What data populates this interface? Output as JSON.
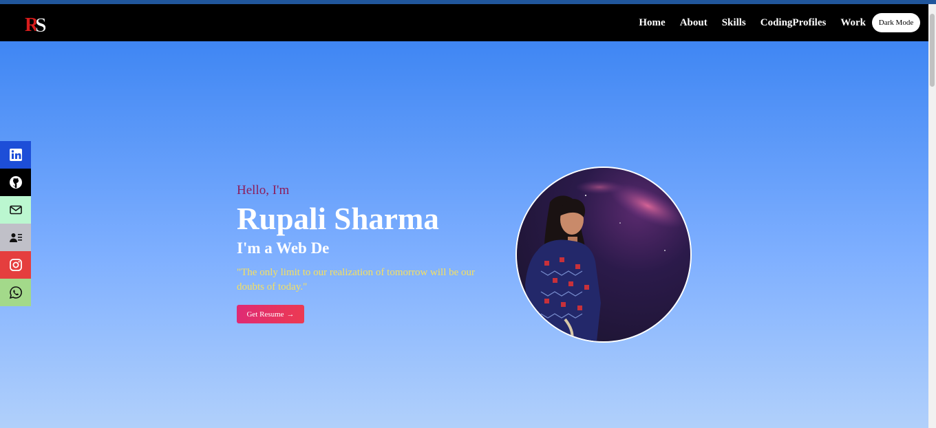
{
  "logo": {
    "text": "RS",
    "icon": "rs-logo-icon"
  },
  "nav": {
    "links": [
      "Home",
      "About",
      "Skills",
      "CodingProfiles",
      "Work"
    ],
    "dark_mode_label": "Dark Mode"
  },
  "social": [
    {
      "icon": "linkedin-icon",
      "color": "#1d4ed8"
    },
    {
      "icon": "github-icon",
      "color": "#000000"
    },
    {
      "icon": "mail-icon",
      "color": "#bbf7d0"
    },
    {
      "icon": "contact-card-icon",
      "color": "#c0c0c8"
    },
    {
      "icon": "instagram-icon",
      "color": "#e53e3e"
    },
    {
      "icon": "whatsapp-icon",
      "color": "#a3d98a"
    }
  ],
  "hero": {
    "greeting": "Hello, I'm",
    "name": "Rupali Sharma",
    "role": "I'm a Web De",
    "quote": "\"The only limit to our realization of tomorrow will be our doubts of today.\"",
    "button_label": "Get Resume",
    "button_arrow": "→"
  },
  "colors": {
    "navbar": "#000000",
    "hero_top": "#3f86f3",
    "hero_bottom": "#b1d0fb",
    "greeting": "#8b1d5c",
    "quote": "#f6e05e",
    "button": "#e23167"
  }
}
